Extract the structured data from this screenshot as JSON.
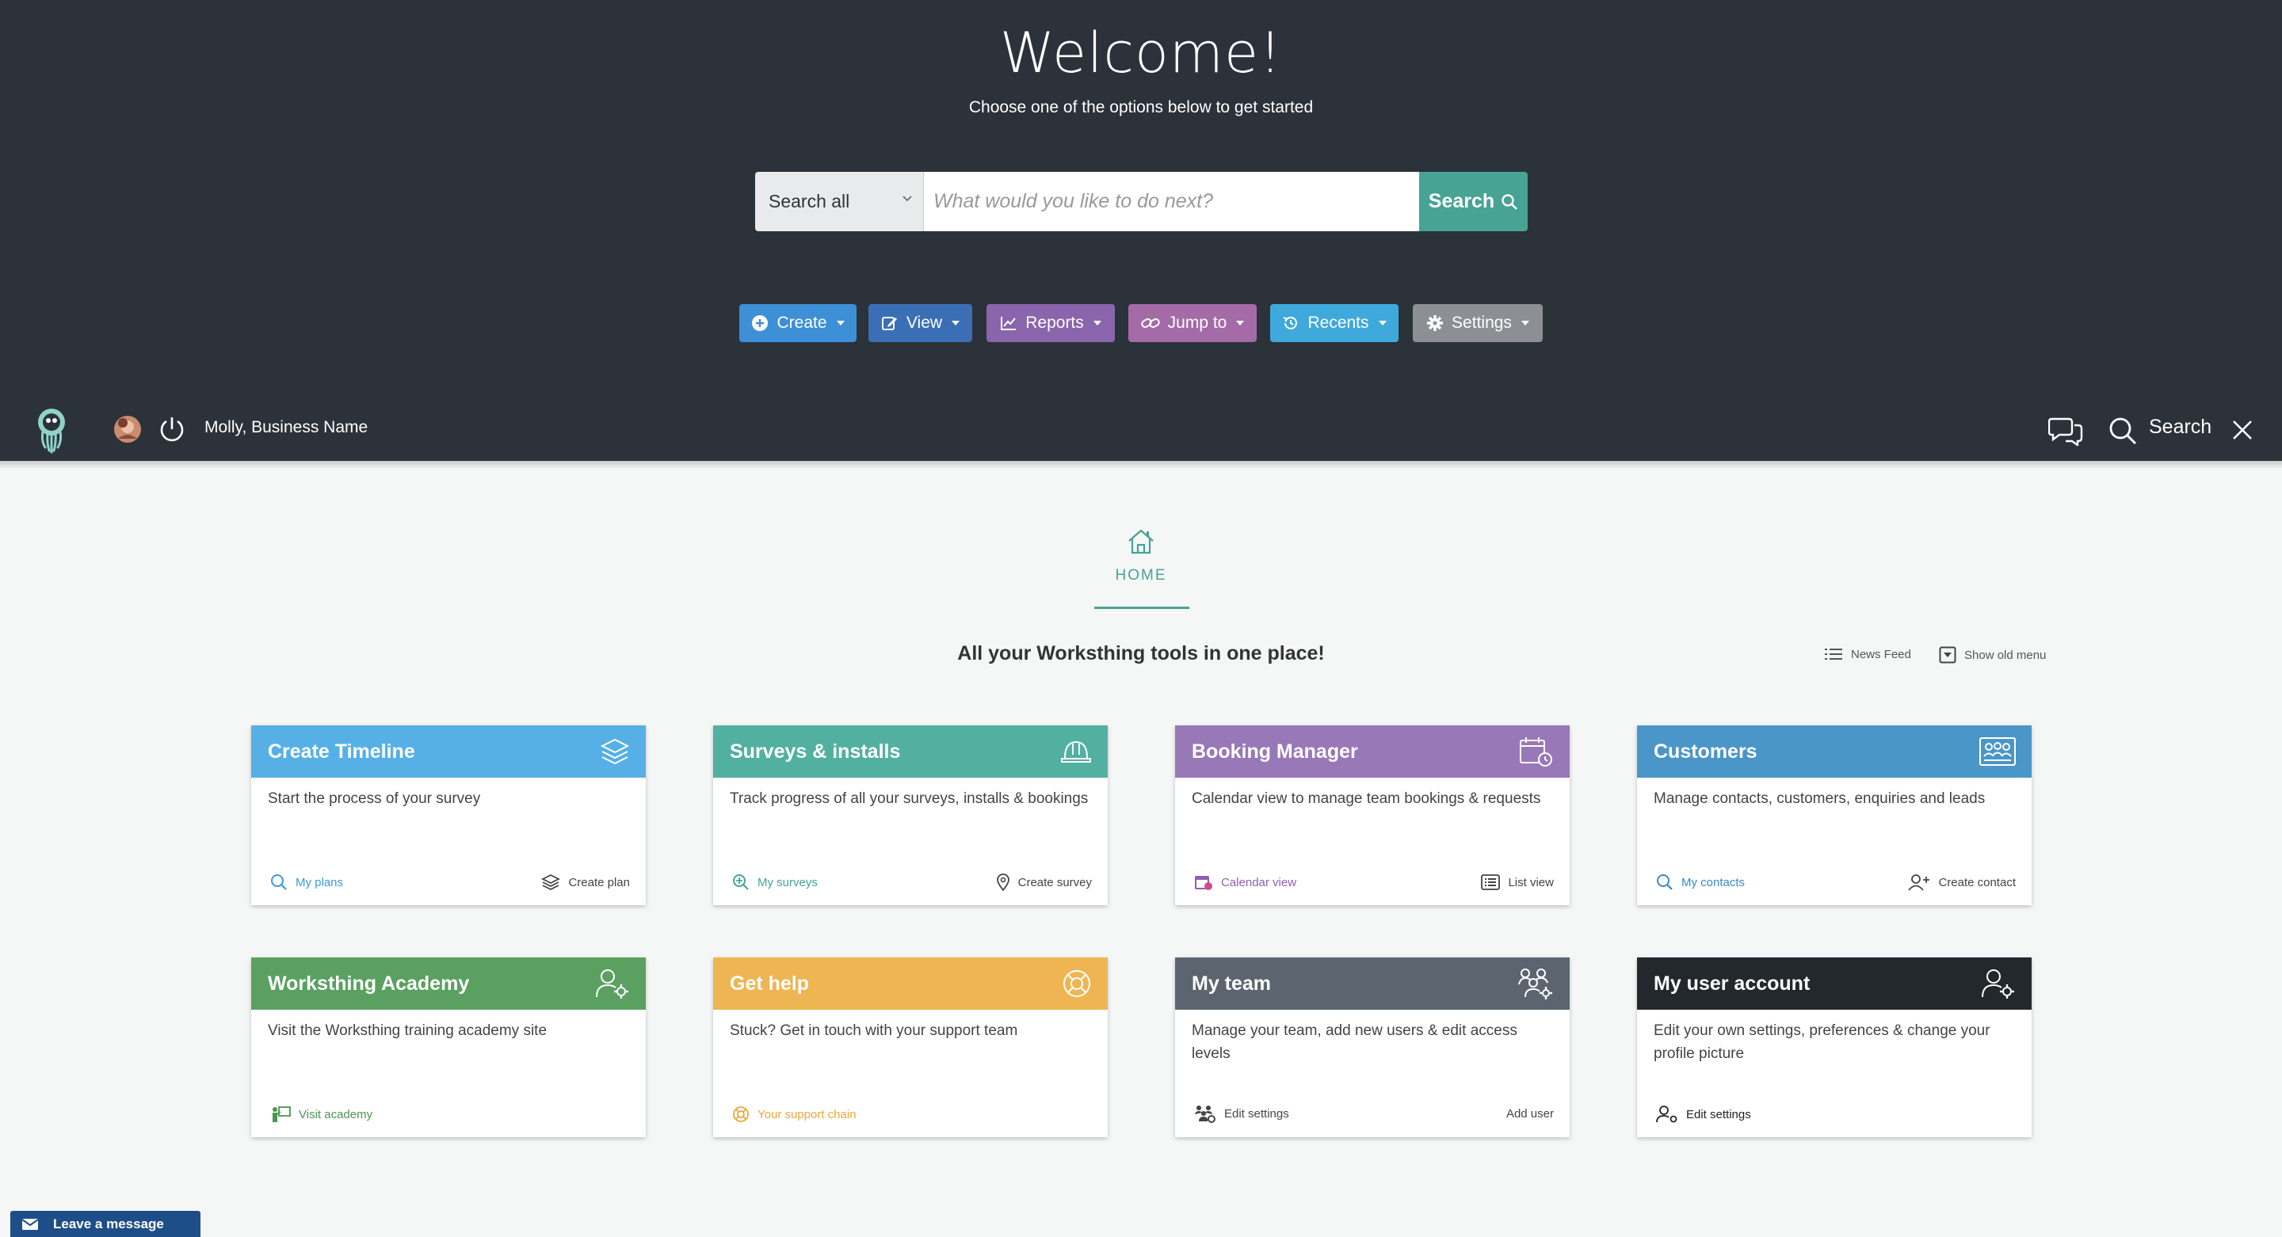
{
  "hero": {
    "title": "Welcome!",
    "subtitle": "Choose one of the options below to get started"
  },
  "search": {
    "scope": "Search all",
    "placeholder": "What would you like to do next?",
    "button": "Search"
  },
  "actions": [
    {
      "label": "Create",
      "icon": "plus-circle-icon",
      "color": "#3d8fd6"
    },
    {
      "label": "View",
      "icon": "edit-icon",
      "color": "#3b6fb5"
    },
    {
      "label": "Reports",
      "icon": "line-chart-icon",
      "color": "#8a65ad"
    },
    {
      "label": "Jump to",
      "icon": "link-icon",
      "color": "#a56aa8"
    },
    {
      "label": "Recents",
      "icon": "history-icon",
      "color": "#3fa9dc"
    },
    {
      "label": "Settings",
      "icon": "gear-icon",
      "color": "#8c9094"
    }
  ],
  "appbar": {
    "user": "Molly, Business Name",
    "search_label": "Search"
  },
  "home": {
    "label": "HOME",
    "tagline": "All your Worksthing tools in one place!",
    "news_feed": "News Feed",
    "show_old_menu": "Show old menu"
  },
  "cards": [
    {
      "title": "Create Timeline",
      "color": "#56b0e6",
      "icon": "layers-icon",
      "desc": "Start the process of your survey",
      "left": "My plans",
      "left_icon": "search-icon",
      "left_color": "#3a9bd9",
      "right": "Create plan",
      "right_icon": "layers-icon"
    },
    {
      "title": "Surveys & installs",
      "color": "#52b0a1",
      "icon": "hard-hat-icon",
      "desc": "Track progress of all your surveys, installs & bookings",
      "left": "My surveys",
      "left_icon": "search-plus-icon",
      "left_color": "#47a394",
      "right": "Create survey",
      "right_icon": "map-pin-icon"
    },
    {
      "title": "Booking Manager",
      "color": "#9978b7",
      "icon": "calendar-clock-icon",
      "desc": "Calendar view to manage team bookings & requests",
      "left": "Calendar view",
      "left_icon": "calendar-icon",
      "left_color": "#8e5fb0",
      "right": "List view",
      "right_icon": "list-icon"
    },
    {
      "title": "Customers",
      "color": "#4a96c9",
      "icon": "group-icon",
      "desc": "Manage contacts, customers, enquiries and leads",
      "left": "My contacts",
      "left_icon": "search-icon",
      "left_color": "#3a8ac4",
      "right": "Create contact",
      "right_icon": "add-user-icon"
    },
    {
      "title": "Worksthing Academy",
      "color": "#5aa161",
      "icon": "user-gear-icon",
      "desc": "Visit the Worksthing training academy site",
      "left": "Visit academy",
      "left_icon": "teacher-icon",
      "left_color": "#4a9552",
      "right": "",
      "right_icon": ""
    },
    {
      "title": "Get help",
      "color": "#efb553",
      "icon": "lifebuoy-icon",
      "desc": "Stuck? Get in touch with your support team",
      "left": "Your support chain",
      "left_icon": "lifebuoy-icon",
      "left_color": "#e8a93a",
      "right": "",
      "right_icon": ""
    },
    {
      "title": "My team",
      "color": "#5c656f",
      "icon": "team-gear-icon",
      "desc": "Manage your team, add new users & edit access levels",
      "left": "Edit settings",
      "left_icon": "team-icon",
      "left_color": "#444",
      "right": "Add user",
      "right_icon": ""
    },
    {
      "title": "My user account",
      "color": "#23282d",
      "icon": "user-gear-icon",
      "desc": "Edit your own settings, preferences & change your profile picture",
      "left": "Edit settings",
      "left_icon": "user-gear-icon",
      "left_color": "#222",
      "right": "",
      "right_icon": ""
    }
  ],
  "chat": {
    "label": "Leave a message"
  }
}
